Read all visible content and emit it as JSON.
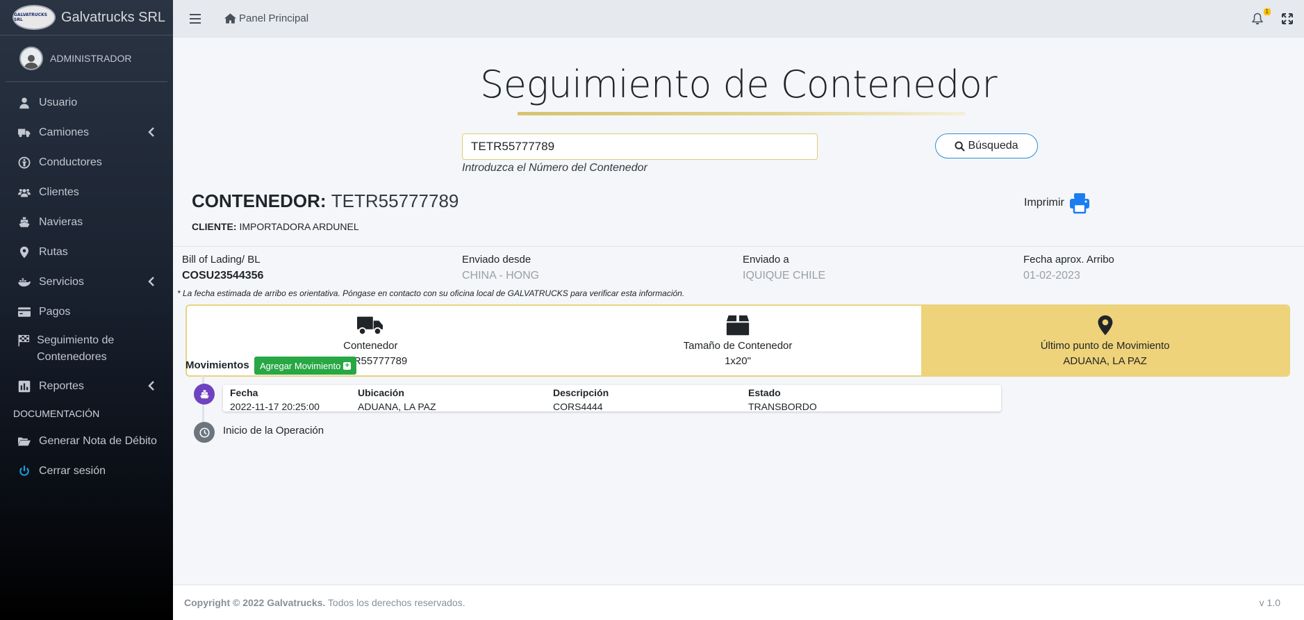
{
  "brand": {
    "name": "Galvatrucks SRL",
    "logo_text": "GALVATRUCKS SRL"
  },
  "user": {
    "name": "ADMINISTRADOR"
  },
  "sidebar": {
    "items": [
      {
        "label": "Usuario",
        "icon": "user-icon"
      },
      {
        "label": "Camiones",
        "icon": "truck-icon",
        "has_children": true
      },
      {
        "label": "Conductores",
        "icon": "driver-icon"
      },
      {
        "label": "Clientes",
        "icon": "users-icon"
      },
      {
        "label": "Navieras",
        "icon": "ship-icon"
      },
      {
        "label": "Rutas",
        "icon": "map-marker-icon"
      },
      {
        "label": "Servicios",
        "icon": "docker-icon",
        "has_children": true
      },
      {
        "label": "Pagos",
        "icon": "credit-card-icon"
      },
      {
        "label": "Seguimiento de Contenedores",
        "icon": "flag-checkered-icon"
      },
      {
        "label": "Reportes",
        "icon": "chart-bar-icon",
        "has_children": true
      }
    ],
    "section_header": "DOCUMENTACIÓN",
    "doc_items": [
      {
        "label": "Generar Nota de Débito",
        "icon": "folder-open-icon"
      },
      {
        "label": "Cerrar sesión",
        "icon": "power-icon"
      }
    ]
  },
  "topbar": {
    "home_label": "Panel Principal",
    "notification_count": "1"
  },
  "page": {
    "title": "Seguimiento de Contenedor",
    "search": {
      "value": "TETR55777789",
      "button_label": "Búsqueda",
      "hint": "Introduzca el Número del Contenedor"
    },
    "container_label": "CONTENEDOR:",
    "container_value": "TETR55777789",
    "client_label": "CLIENTE:",
    "client_value": "IMPORTADORA ARDUNEL",
    "print_label": "Imprimir",
    "info": [
      {
        "label": "Bill of Lading/ BL",
        "value": "COSU23544356"
      },
      {
        "label": "Enviado desde",
        "value": "CHINA - HONG"
      },
      {
        "label": "Enviado a",
        "value": "IQUIQUE CHILE"
      },
      {
        "label": "Fecha aprox. Arribo",
        "value": "01-02-2023"
      }
    ],
    "disclaimer": "* La fecha estimada de arribo es orientativa. Póngase en contacto con su oficina local de GALVATRUCKS para verificar esta información.",
    "stats": [
      {
        "label": "Contenedor",
        "value": "TETR55777789",
        "icon": "truck-icon"
      },
      {
        "label": "Tamaño de Contenedor",
        "value": "1x20\"",
        "icon": "box-icon"
      },
      {
        "label": "Último punto de Movimiento",
        "value": "ADUANA, LA PAZ",
        "icon": "map-marker-icon"
      }
    ],
    "movements_title": "Movimientos",
    "add_movement_label": "Agregar Movimiento",
    "movement_columns": [
      "Fecha",
      "Ubicación",
      "Descripción",
      "Estado"
    ],
    "movements": [
      {
        "fecha": "2022-11-17 20:25:00",
        "ubicacion": "ADUANA, LA PAZ",
        "descripcion": "CORS4444",
        "estado": "TRANSBORDO"
      }
    ],
    "timeline_end": "Inicio de la Operación"
  },
  "footer": {
    "copyright_bold": "Copyright © 2022 Galvatrucks.",
    "copyright_rest": "Todos los derechos reservados.",
    "version": "v 1.0"
  },
  "colors": {
    "accent_gold": "#efd37a",
    "primary_blue": "#2b8fd6",
    "success_green": "#28a745",
    "timeline_purple": "#6f42c1"
  }
}
